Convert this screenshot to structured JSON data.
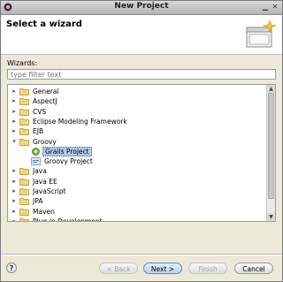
{
  "window": {
    "title": "New Project"
  },
  "header": {
    "heading": "Select a wizard"
  },
  "wizards_label": "Wizards:",
  "filter": {
    "placeholder": "type filter text"
  },
  "tree": [
    {
      "label": "General",
      "depth": 0,
      "expanded": false,
      "kind": "folder"
    },
    {
      "label": "AspectJ",
      "depth": 0,
      "expanded": false,
      "kind": "folder"
    },
    {
      "label": "CVS",
      "depth": 0,
      "expanded": false,
      "kind": "folder"
    },
    {
      "label": "Eclipse Modeling Framework",
      "depth": 0,
      "expanded": false,
      "kind": "folder"
    },
    {
      "label": "EJB",
      "depth": 0,
      "expanded": false,
      "kind": "folder"
    },
    {
      "label": "Groovy",
      "depth": 0,
      "expanded": true,
      "kind": "folder"
    },
    {
      "label": "Grails Project",
      "depth": 1,
      "selected": true,
      "kind": "grails"
    },
    {
      "label": "Groovy Project",
      "depth": 1,
      "kind": "project"
    },
    {
      "label": "Java",
      "depth": 0,
      "expanded": false,
      "kind": "folder"
    },
    {
      "label": "Java EE",
      "depth": 0,
      "expanded": false,
      "kind": "folder"
    },
    {
      "label": "JavaScript",
      "depth": 0,
      "expanded": false,
      "kind": "folder"
    },
    {
      "label": "JPA",
      "depth": 0,
      "expanded": false,
      "kind": "folder"
    },
    {
      "label": "Maven",
      "depth": 0,
      "expanded": false,
      "kind": "folder"
    },
    {
      "label": "Plug-in Development",
      "depth": 0,
      "expanded": false,
      "kind": "folder"
    }
  ],
  "buttons": {
    "help": "?",
    "back": "< Back",
    "next": "Next >",
    "finish": "Finish",
    "cancel": "Cancel"
  }
}
